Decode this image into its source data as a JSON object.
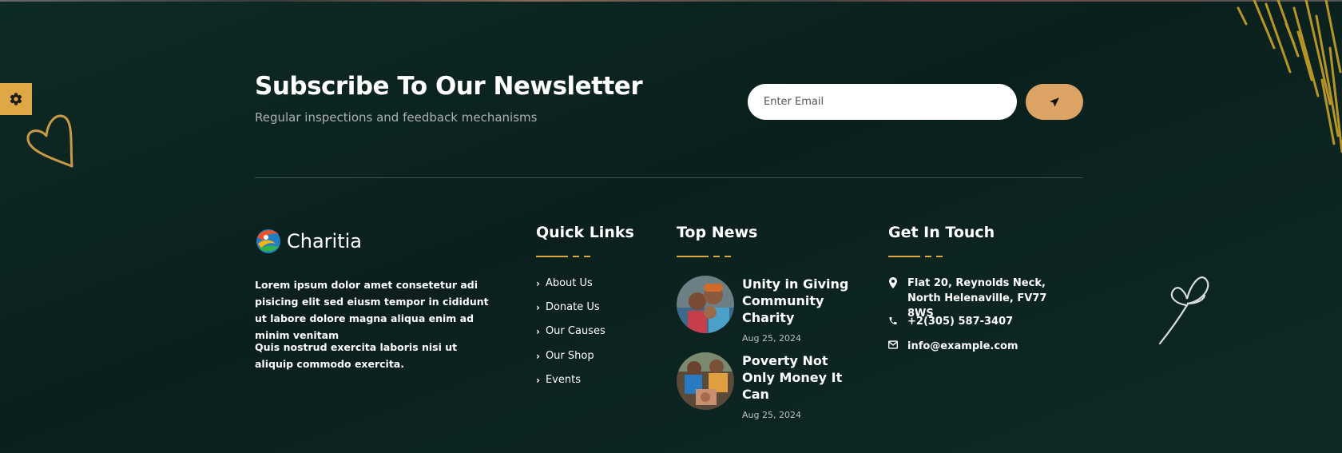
{
  "newsletter": {
    "title": "Subscribe To Our Newsletter",
    "subtitle": "Regular inspections and feedback mechanisms",
    "email_placeholder": "Enter Email",
    "send_icon": "paper-plane-icon"
  },
  "brand": {
    "name": "Charitia",
    "paragraph_1": "Lorem ipsum dolor amet consetetur adi pisicing elit sed eiusm tempor in cididunt ut labore dolore magna aliqua enim ad minim venitam",
    "paragraph_2": "Quis nostrud exercita laboris nisi ut aliquip commodo exercita."
  },
  "quick_links": {
    "title": "Quick Links",
    "items": [
      "About Us",
      "Donate Us",
      "Our Causes",
      "Our Shop",
      "Events"
    ]
  },
  "top_news": {
    "title": "Top News",
    "items": [
      {
        "title": "Unity in Giving Community Charity",
        "date": "Aug 25, 2024"
      },
      {
        "title": "Poverty Not Only Money It Can",
        "date": "Aug 25, 2024"
      }
    ]
  },
  "contact": {
    "title": "Get In Touch",
    "address": "Flat 20, Reynolds Neck, North Helenaville, FV77 8WS",
    "phone": "+2(305) 587-3407",
    "email": "info@example.com"
  },
  "colors": {
    "background": "#0e2824",
    "accent": "#e0a844",
    "button": "#dba464"
  }
}
